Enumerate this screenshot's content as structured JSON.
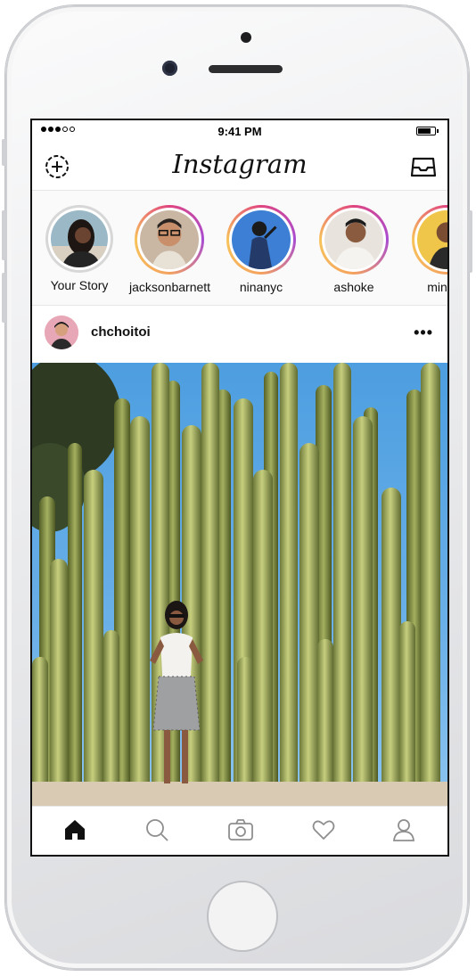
{
  "status_bar": {
    "time": "9:41 PM"
  },
  "app": {
    "title": "Instagram",
    "new_story_icon": "add-story-icon",
    "inbox_icon": "inbox-tray-icon"
  },
  "stories": [
    {
      "name": "Your Story"
    },
    {
      "name": "jacksonbarnett"
    },
    {
      "name": "ninanyc"
    },
    {
      "name": "ashoke"
    },
    {
      "name": "minzzz"
    }
  ],
  "post": {
    "username": "chchoitoi",
    "more_label": "•••"
  },
  "tab_bar": {
    "items": [
      "home-icon",
      "search-icon",
      "camera-icon",
      "heart-icon",
      "profile-icon"
    ]
  },
  "colors": {
    "story_ring_gradient": [
      "#e0447f",
      "#a84cd1",
      "#f4a25e",
      "#f7c35a"
    ],
    "sky": "#4d9ee0",
    "cactus": "#a9b65f"
  }
}
